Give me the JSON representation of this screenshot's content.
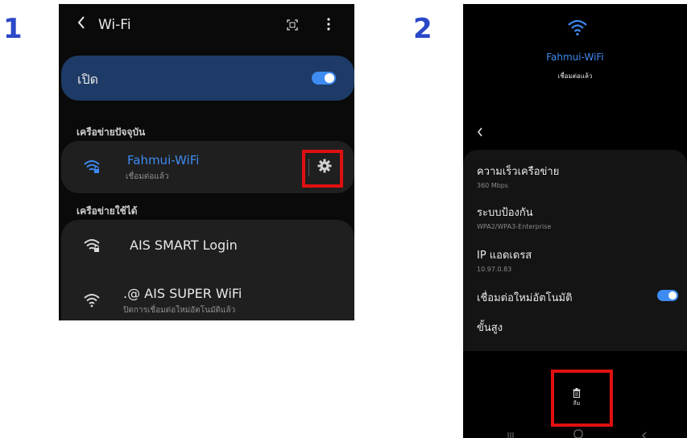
{
  "steps": {
    "one": "1",
    "two": "2"
  },
  "screen1": {
    "title": "Wi-Fi",
    "toggle_label": "เปิด",
    "current_section": "เครือข่ายปัจจุบัน",
    "current_network": {
      "name": "Fahmui-WiFi",
      "status": "เชื่อมต่อแล้ว"
    },
    "available_section": "เครือข่ายใช้ได้",
    "available": [
      {
        "name": "AIS SMART Login",
        "status": ""
      },
      {
        "name": ".@ AIS SUPER WiFi",
        "status": "ปิดการเชื่อมต่อใหม่อัตโนมัติแล้ว"
      }
    ]
  },
  "screen2": {
    "network_name": "Fahmui-WiFi",
    "status": "เชื่อมต่อแล้ว",
    "rows": [
      {
        "label": "ความเร็วเครือข่าย",
        "value": "360 Mbps"
      },
      {
        "label": "ระบบป้องกัน",
        "value": "WPA2/WPA3-Enterprise"
      },
      {
        "label": "IP แอดเดรส",
        "value": "10.97.0.83"
      }
    ],
    "auto_reconnect_label": "เชื่อมต่อใหม่อัตโนมัติ",
    "advanced_label": "ขั้นสูง",
    "forget_label": "ลืม"
  },
  "colors": {
    "highlight": "#e01010",
    "accent": "#3e8bf2",
    "step_number": "#2b48c8"
  }
}
